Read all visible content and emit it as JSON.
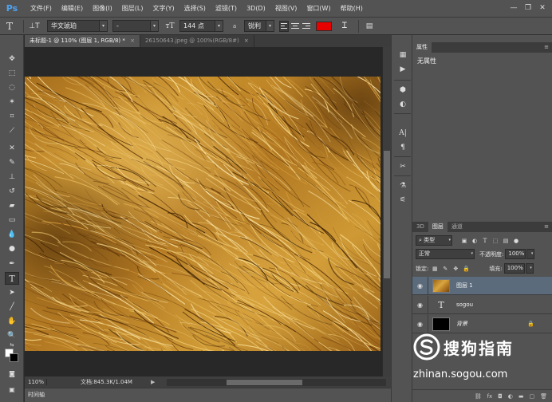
{
  "app": {
    "logo": "Ps"
  },
  "menu": [
    "文件(F)",
    "编辑(E)",
    "图像(I)",
    "图层(L)",
    "文字(Y)",
    "选择(S)",
    "滤镜(T)",
    "3D(D)",
    "视图(V)",
    "窗口(W)",
    "帮助(H)"
  ],
  "window_controls": {
    "minimize": "—",
    "restore": "❐",
    "close": "✕"
  },
  "options": {
    "font_family": "华文琥珀",
    "font_style": "-",
    "font_size": "144 点",
    "aa_label": "a",
    "aa_mode": "锐利",
    "text_color": "#e60000"
  },
  "tabs": [
    {
      "label": "未标题-1 @ 110% (图层 1, RGB/8) *",
      "close": "×"
    },
    {
      "label": "26150643.jpeg @ 100%(RGB/8#)",
      "close": "×"
    }
  ],
  "status": {
    "zoom": "110%",
    "doc": "文档:845.3K/1.04M",
    "arrow": "▶"
  },
  "timeline": {
    "label": "时间轴"
  },
  "properties": {
    "tab": "属性",
    "message": "无属性"
  },
  "layers_panel": {
    "tabs": [
      "3D",
      "图层",
      "通道"
    ],
    "filter_kind": "类型",
    "blend_mode": "正常",
    "opacity_label": "不透明度:",
    "opacity_value": "100%",
    "lock_label": "锁定:",
    "fill_label": "填充:",
    "fill_value": "100%",
    "layers": [
      {
        "name": "图层 1",
        "type": "image",
        "selected": true
      },
      {
        "name": "sogou",
        "type": "text",
        "selected": false
      },
      {
        "name": "背景",
        "type": "background",
        "selected": false
      }
    ],
    "bottom_icons": [
      "link-icon",
      "fx",
      "mask-icon",
      "adjustment-icon",
      "group-icon",
      "new-layer-icon",
      "trash-icon"
    ]
  },
  "watermark": {
    "brand": "搜狗指南",
    "url": "zhinan.sogou.com"
  },
  "colors": {
    "accent": "#4ea3f4",
    "selected_layer": "#5b6b7c",
    "foreground": "#ffffff",
    "background": "#000000"
  }
}
